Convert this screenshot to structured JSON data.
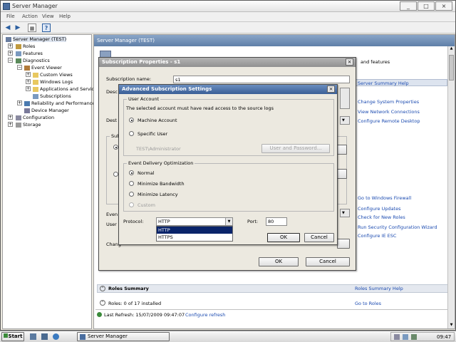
{
  "window": {
    "title": "Server Manager",
    "min": "_",
    "max": "□",
    "close": "×"
  },
  "menu": [
    "File",
    "Action",
    "View",
    "Help"
  ],
  "tree": {
    "root": "Server Manager (TEST)",
    "roles": "Roles",
    "features": "Features",
    "diagnostics": "Diagnostics",
    "event_viewer": "Event Viewer",
    "custom_views": "Custom Views",
    "windows_logs": "Windows Logs",
    "app_logs": "Applications and Servic",
    "subscriptions": "Subscriptions",
    "reliability": "Reliability and Performance",
    "device_manager": "Device Manager",
    "configuration": "Configuration",
    "storage": "Storage"
  },
  "main": {
    "header": "Server Manager (TEST)",
    "features_suffix": "and features",
    "server_summary_help": "Server Summary Help",
    "links": [
      "Change System Properties",
      "View Network Connections",
      "Configure Remote Desktop"
    ],
    "links2": [
      "Go to Windows Firewall",
      "Configure Updates",
      "Check for New Roles",
      "Run Security Configuration Wizard",
      "Configure IE ESC"
    ],
    "roles_summary": "Roles Summary",
    "roles_summary_help": "Roles Summary Help",
    "roles_count": "Roles: 0 of 17 installed",
    "go_to_roles": "Go to Roles",
    "last_refresh": "Last Refresh: 15/07/2009 09:47:07",
    "configure_refresh": "Configure refresh"
  },
  "sub_props": {
    "title": "Subscription Properties - s1",
    "name_label": "Subscription name:",
    "name_value": "s1",
    "partial": [
      "Desc",
      "Dest",
      "Sub",
      "Even",
      "User",
      "Chang"
    ],
    "ok": "OK",
    "cancel": "Cancel"
  },
  "adv": {
    "title": "Advanced Subscription Settings",
    "user_account_group": "User Account",
    "user_account_desc": "The selected account must have read access to the source logs",
    "machine_account": "Machine Account",
    "specific_user": "Specific User",
    "specific_user_value": "TEST\\Administrator",
    "user_password_button": "User and Password...",
    "delivery_group": "Event Delivery Optimization",
    "normal": "Normal",
    "min_bandwidth": "Minimize Bandwidth",
    "min_latency": "Minimize Latency",
    "custom": "Custom",
    "protocol_label": "Protocol:",
    "protocol_value": "HTTP",
    "protocol_options": [
      "HTTP",
      "HTTPS"
    ],
    "port_label": "Port:",
    "port_value": "80",
    "ok": "OK",
    "cancel": "Cancel"
  },
  "taskbar": {
    "start": "Start",
    "task": "Server Manager",
    "clock": "09:47"
  },
  "colors": {
    "accent": "#3a5e96",
    "selection": "#0a246a"
  }
}
